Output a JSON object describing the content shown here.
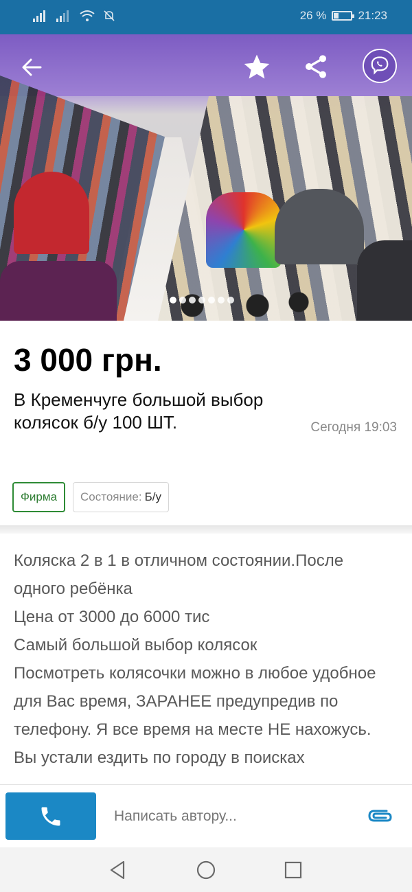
{
  "status_bar": {
    "battery_text": "26 %",
    "battery_level": 0.26,
    "time": "21:23"
  },
  "header_icons": {
    "back": "arrow-left-icon",
    "favorite": "star-icon",
    "share": "share-icon",
    "viber": "viber-icon"
  },
  "gallery": {
    "photo_count": 7,
    "active_index": 0
  },
  "listing": {
    "price": "3 000 грн.",
    "title": "В Кременчуге большой выбор колясок б/у 100 ШТ.",
    "date": "Сегодня 19:03",
    "tags": {
      "seller_type": "Фирма",
      "condition_label": "Состояние:",
      "condition_value": "Б/у"
    },
    "description": [
      "Коляска 2 в 1 в отличном состоянии.После одного ребёнка",
      "Цена от 3000 до 6000 тис",
      "Самый большой выбор колясок",
      "Посмотреть колясочки можно в любое удобное для Вас время,  ЗАРАНЕЕ предупредив по телефону. Я все время на месте НЕ нахожусь.",
      "Вы устали ездить по городу в поисках"
    ]
  },
  "bottom_bar": {
    "call_icon": "phone-icon",
    "message_placeholder": "Написать автору...",
    "attach_icon": "paperclip-icon"
  },
  "colors": {
    "primary": "#1a6fa4",
    "call_button": "#1b88c5",
    "firma_green": "#2e8b35",
    "viber_purple": "#6f4fb7"
  }
}
